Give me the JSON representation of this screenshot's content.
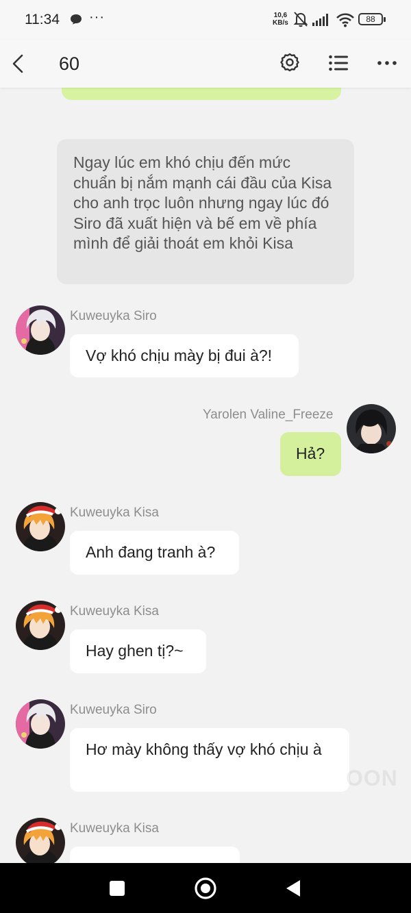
{
  "status_bar": {
    "time": "11:34",
    "more": "···",
    "net_speed_value": "10,6",
    "net_speed_unit": "KB/s",
    "battery": "88",
    "icons": [
      "message-icon",
      "mute-bell-icon",
      "signal-icon",
      "wifi-icon",
      "battery-icon"
    ]
  },
  "header": {
    "title": "60",
    "icons": [
      "back-icon",
      "gear-icon",
      "list-icon",
      "more-icon"
    ]
  },
  "narration": "Ngay lúc em khó chịu đến mức chuẩn bị nắm mạnh cái đầu của Kisa cho anh trọc luôn nhưng ngay lúc đó Siro đã xuất hiện và bế em về phía mình để giải thoát em khỏi Kisa",
  "messages": [
    {
      "sender": "Kuweuyka Siro",
      "text": "Vợ khó chịu mày bị đui à?!"
    },
    {
      "sender": "Yarolen Valine_Freeze",
      "text": "Hả?"
    },
    {
      "sender": "Kuweuyka Kisa",
      "text": "Anh đang tranh à?"
    },
    {
      "sender": "Kuweuyka Kisa",
      "text": "Hay ghen tị?~"
    },
    {
      "sender": "Kuweuyka Siro",
      "text": "Hơ mày không thấy vợ khó chịu à"
    },
    {
      "sender": "Kuweuyka Kisa",
      "text": ""
    }
  ],
  "watermark": "OON",
  "colors": {
    "background": "#f2f2f2",
    "my_bubble": "#d5f09c",
    "other_bubble": "#ffffff",
    "narration_bubble": "#e6e6e6",
    "sender_name": "#8d8d8d"
  }
}
